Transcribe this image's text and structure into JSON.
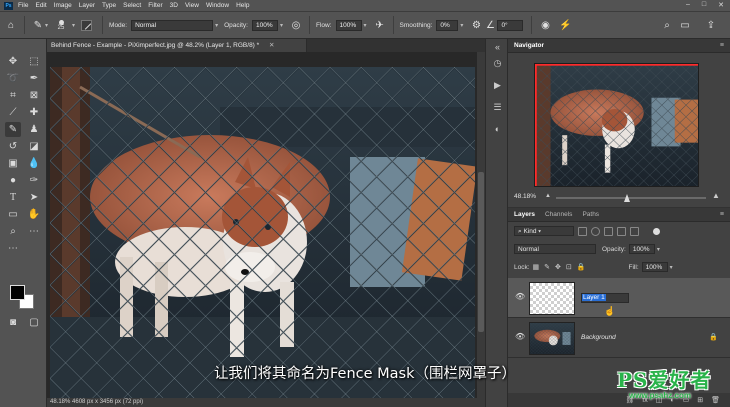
{
  "menubar": {
    "logo": "Ps",
    "items": [
      "File",
      "Edit",
      "Image",
      "Layer",
      "Type",
      "Select",
      "Filter",
      "3D",
      "View",
      "Window",
      "Help"
    ],
    "controls": [
      "–",
      "□",
      "✕"
    ]
  },
  "options": {
    "brush_size": "25",
    "mode_label": "Mode:",
    "mode_value": "Normal",
    "opacity_label": "Opacity:",
    "opacity_value": "100%",
    "flow_label": "Flow:",
    "flow_value": "100%",
    "smoothing_label": "Smoothing:",
    "smoothing_value": "0%",
    "angle_value": "0°"
  },
  "document": {
    "tab_title": "Behind Fence - Example - PiXimperfect.jpg @ 48.2% (Layer 1, RGB/8) *",
    "status": "48.18%    4608 px x 3456 px (72 ppi)"
  },
  "navigator": {
    "title": "Navigator",
    "zoom": "48.18%"
  },
  "layers_panel": {
    "tabs": [
      "Layers",
      "Channels",
      "Paths"
    ],
    "filter_kind": "Kind",
    "blend_mode": "Normal",
    "opacity_label": "Opacity:",
    "opacity_value": "100%",
    "lock_label": "Lock:",
    "fill_label": "Fill:",
    "fill_value": "100%",
    "layers": [
      {
        "name": "Layer 1",
        "selected": true,
        "editing": true
      },
      {
        "name": "Background",
        "selected": false,
        "locked": true
      }
    ],
    "footer_icons": [
      "fx",
      "◫",
      "◐",
      "▭",
      "⊞",
      "🗑"
    ]
  },
  "subtitle": "让我们将其命名为Fence Mask（围栏网罩子）",
  "watermark": {
    "logo_text": "PS爱好者",
    "url": "www.psahz.com",
    "color": "#29b34a"
  },
  "colors": {
    "app_bg": "#323232",
    "panel_bg": "#424242",
    "bar_bg": "#535353",
    "selection": "#2a6fd6"
  }
}
